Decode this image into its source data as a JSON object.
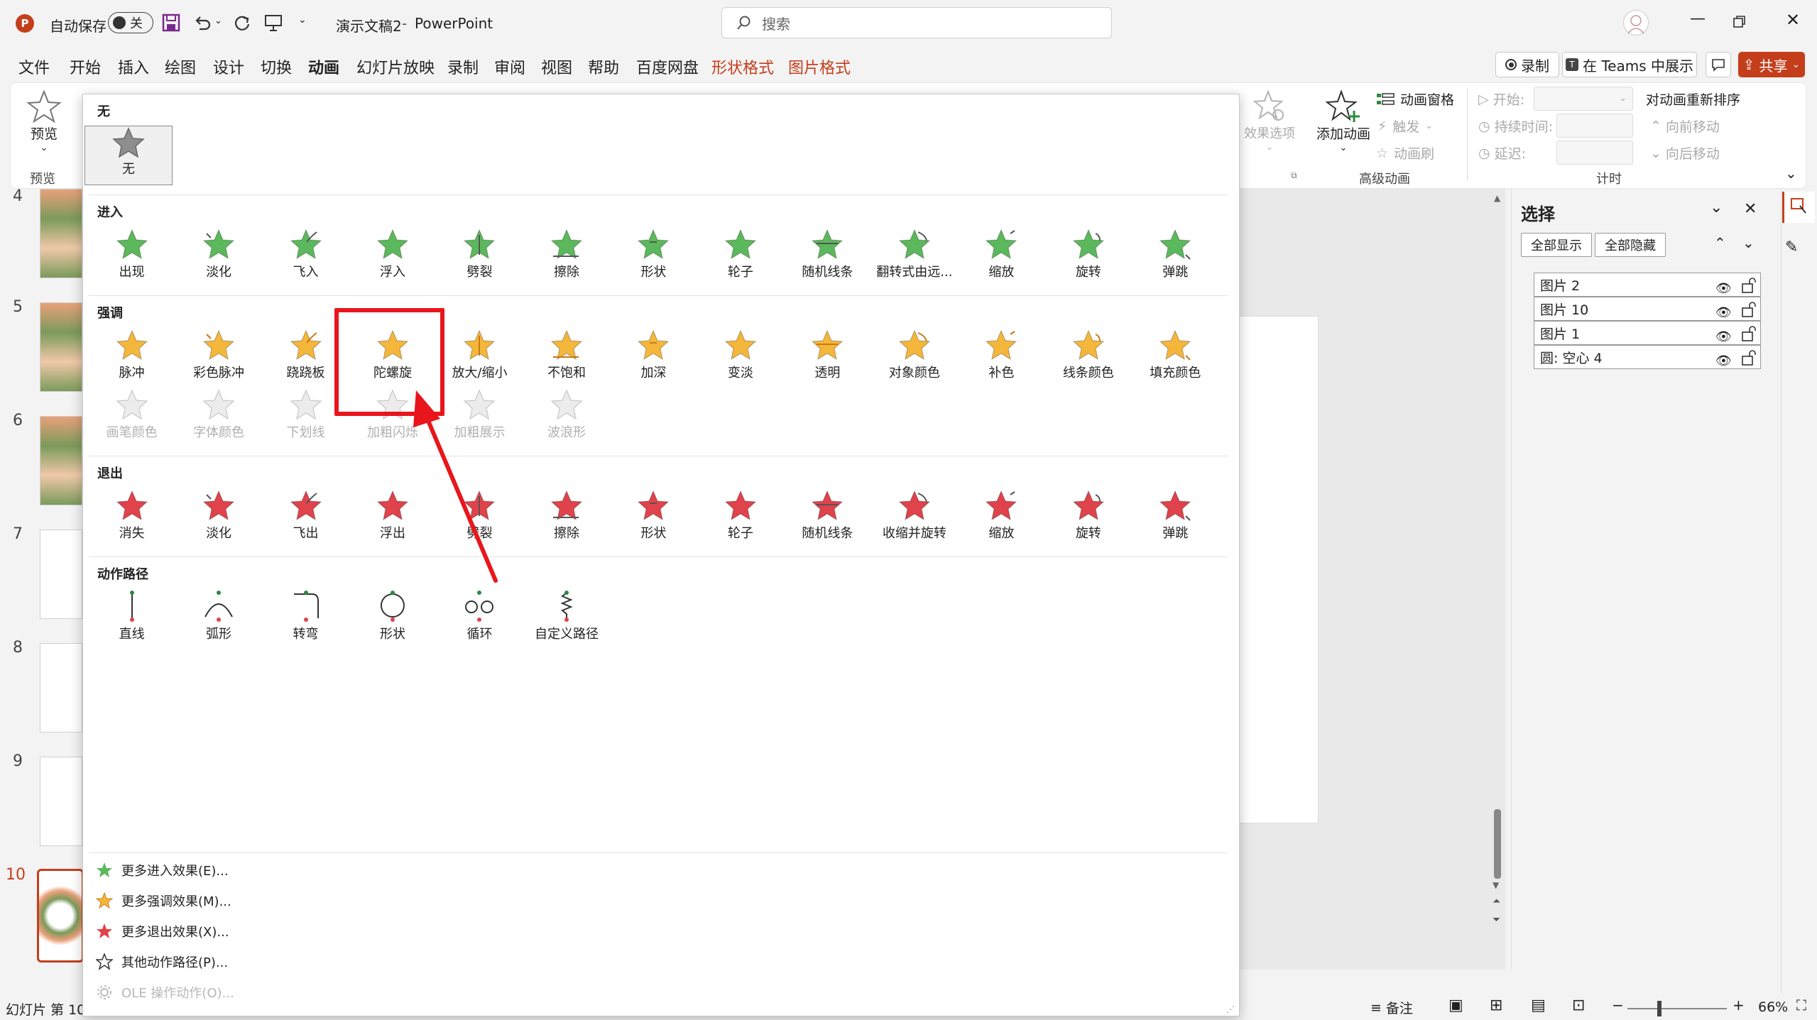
{
  "app": {
    "autosave_label": "自动保存",
    "autosave_state": "关",
    "doc_title": "演示文稿2",
    "app_name": "PowerPoint",
    "search_placeholder": "搜索"
  },
  "menu": {
    "tabs": [
      "文件",
      "开始",
      "插入",
      "绘图",
      "设计",
      "切换",
      "动画",
      "幻灯片放映",
      "录制",
      "审阅",
      "视图",
      "帮助",
      "百度网盘",
      "形状格式",
      "图片格式"
    ],
    "active_tab": "动画",
    "record_btn": "录制",
    "teams_btn": "在 Teams 中展示",
    "share_btn": "共享"
  },
  "ribbon": {
    "preview": "预览",
    "preview_group": "预览",
    "effect_options": "效果选项",
    "add_animation": "添加动画",
    "animation_pane": "动画窗格",
    "trigger": "触发",
    "animation_painter": "动画刷",
    "advanced_group": "高级动画",
    "start": "开始:",
    "duration": "持续时间:",
    "delay": "延迟:",
    "reorder": "对动画重新排序",
    "move_earlier": "向前移动",
    "move_later": "向后移动",
    "timing_group": "计时"
  },
  "gallery": {
    "none_header": "无",
    "none_item": "无",
    "entrance_header": "进入",
    "entrance": [
      "出现",
      "淡化",
      "飞入",
      "浮入",
      "劈裂",
      "擦除",
      "形状",
      "轮子",
      "随机线条",
      "翻转式由远...",
      "缩放",
      "旋转",
      "弹跳"
    ],
    "emphasis_header": "强调",
    "emphasis": [
      "脉冲",
      "彩色脉冲",
      "跷跷板",
      "陀螺旋",
      "放大/缩小",
      "不饱和",
      "加深",
      "变淡",
      "透明",
      "对象颜色",
      "补色",
      "线条颜色",
      "填充颜色"
    ],
    "emphasis_disabled": [
      "画笔颜色",
      "字体颜色",
      "下划线",
      "加粗闪烁",
      "加粗展示",
      "波浪形"
    ],
    "exit_header": "退出",
    "exit": [
      "消失",
      "淡化",
      "飞出",
      "浮出",
      "劈裂",
      "擦除",
      "形状",
      "轮子",
      "随机线条",
      "收缩并旋转",
      "缩放",
      "旋转",
      "弹跳"
    ],
    "path_header": "动作路径",
    "paths": [
      "直线",
      "弧形",
      "转弯",
      "形状",
      "循环",
      "自定义路径"
    ],
    "more": [
      "更多进入效果(E)...",
      "更多强调效果(M)...",
      "更多退出效果(X)...",
      "其他动作路径(P)...",
      "OLE 操作动作(O)..."
    ]
  },
  "selection_pane": {
    "title": "选择",
    "show_all": "全部显示",
    "hide_all": "全部隐藏",
    "items": [
      "图片 2",
      "图片 10",
      "图片 1",
      "圆: 空心 4"
    ]
  },
  "thumbnails": {
    "numbers": [
      "4",
      "5",
      "6",
      "7",
      "8",
      "9",
      "10"
    ],
    "current": "10"
  },
  "status": {
    "slide_info": "幻灯片 第 10",
    "notes": "备注",
    "zoom": "66%"
  },
  "colors": {
    "accent": "#c43e1c",
    "entrance_star": "#5cb85c",
    "emphasis_star": "#f5b73b",
    "exit_star": "#e0434b",
    "highlight_box": "#e8161c"
  }
}
